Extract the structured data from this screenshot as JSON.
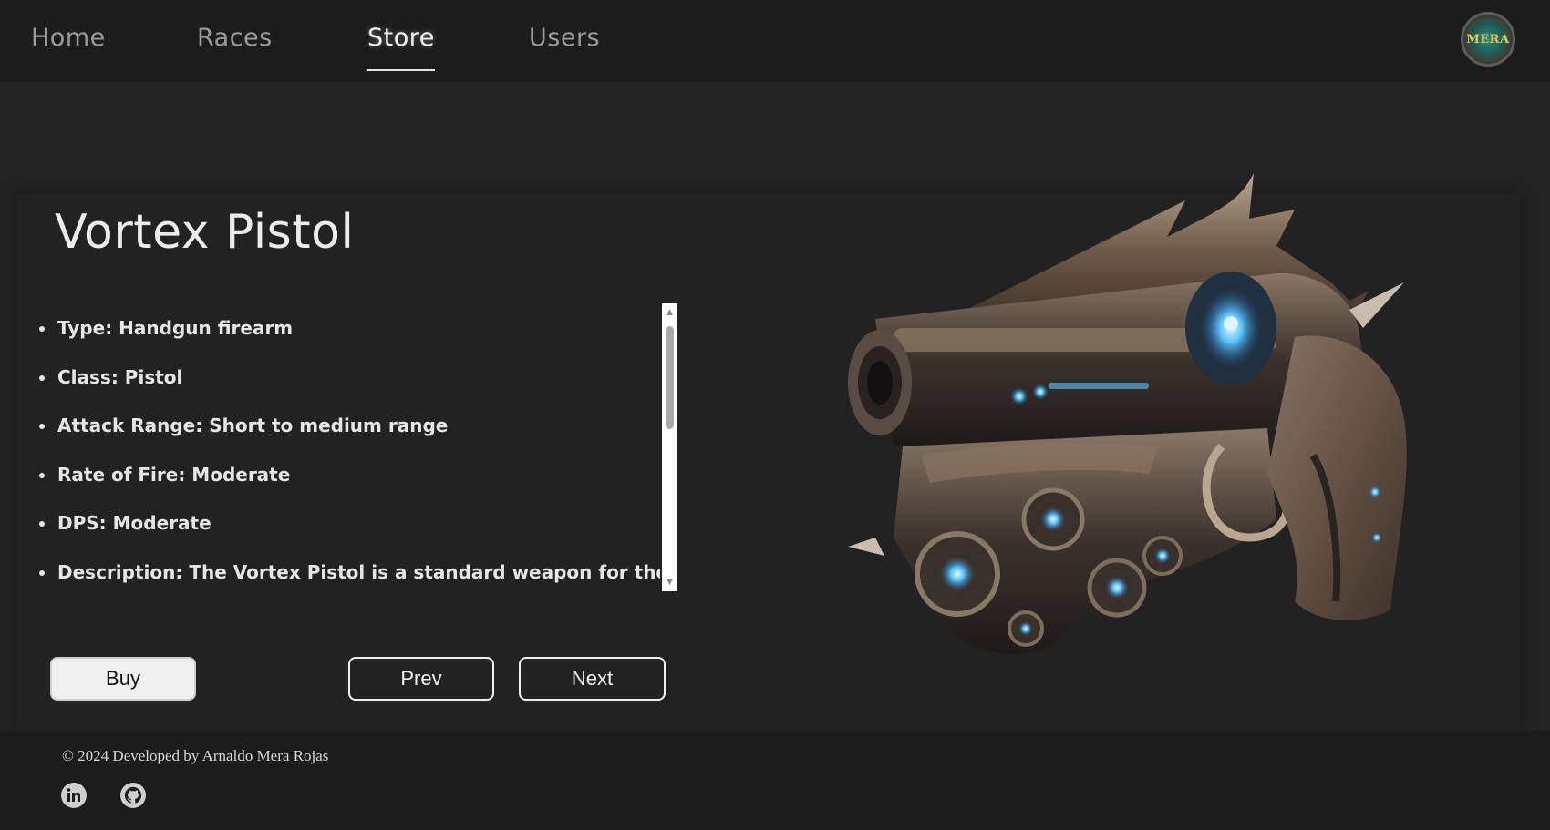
{
  "nav": {
    "items": [
      {
        "label": "Home",
        "active": false
      },
      {
        "label": "Races",
        "active": false
      },
      {
        "label": "Store",
        "active": true
      },
      {
        "label": "Users",
        "active": false
      }
    ],
    "logo_text": "MERA"
  },
  "product": {
    "title": "Vortex Pistol",
    "details": [
      "Type: Handgun firearm",
      "Class: Pistol",
      "Attack Range: Short to medium range",
      "Rate of Fire: Moderate",
      "DPS: Moderate",
      "Description: The Vortex Pistol is a standard weapon for the"
    ],
    "image_icon": "vortex-pistol-image"
  },
  "actions": {
    "buy_label": "Buy",
    "prev_label": "Prev",
    "next_label": "Next"
  },
  "footer": {
    "copyright": "© 2024 Developed by Arnaldo Mera Rojas",
    "socials": [
      {
        "icon": "linkedin-icon"
      },
      {
        "icon": "github-icon"
      }
    ]
  },
  "colors": {
    "background": "#232323",
    "nav_background": "#1c1c1c",
    "accent_glow": "#4fb8ff"
  }
}
